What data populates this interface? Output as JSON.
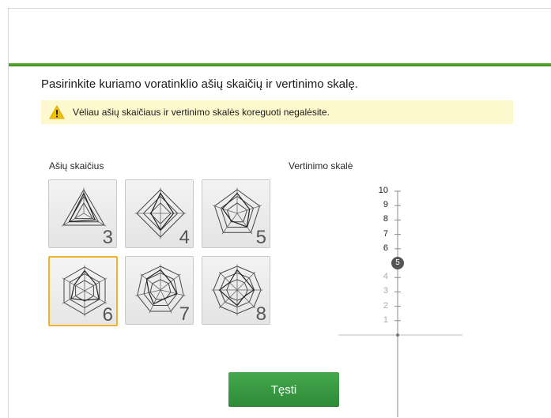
{
  "heading": "Pasirinkite kuriamo voratinklio ašių skaičių ir vertinimo skalę.",
  "warning": {
    "icon": "warning-icon",
    "text": "Vėliau ašių skaičiaus ir vertinimo skalės koreguoti negalėsite."
  },
  "axes": {
    "label": "Ašių skaičius",
    "options": [
      {
        "value": "3",
        "selected": false
      },
      {
        "value": "4",
        "selected": false
      },
      {
        "value": "5",
        "selected": false
      },
      {
        "value": "6",
        "selected": true
      },
      {
        "value": "7",
        "selected": false
      },
      {
        "value": "8",
        "selected": false
      }
    ]
  },
  "scale": {
    "label": "Vertinimo skalė",
    "ticks": [
      "10",
      "9",
      "8",
      "7",
      "6",
      "5",
      "4",
      "3",
      "2",
      "1"
    ],
    "selected": "5"
  },
  "continue_button": "Tęsti",
  "colors": {
    "accent_green": "#4caf32",
    "button_green": "#3a9a43",
    "selected_border": "#f0b429",
    "warning_bg": "#fdf8cd"
  }
}
